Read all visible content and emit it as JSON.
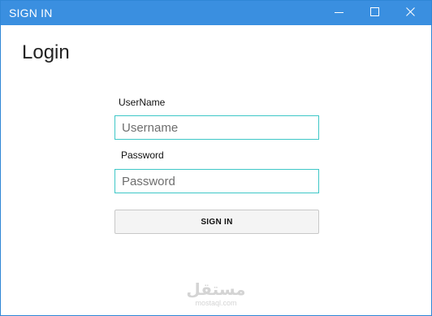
{
  "window": {
    "title": "SIGN IN",
    "controls": {
      "minimize_icon": "minimize-icon",
      "maximize_icon": "maximize-icon",
      "close_icon": "close-icon"
    },
    "accent_color": "#3a8fe0"
  },
  "main": {
    "heading": "Login",
    "username": {
      "label": "UserName",
      "placeholder": "Username",
      "value": ""
    },
    "password": {
      "label": "Password",
      "placeholder": "Password",
      "value": ""
    },
    "submit_label": "SIGN IN",
    "input_border_color": "#3ec7c7"
  },
  "watermark": {
    "main": "مستقل",
    "sub": "mostaql.com"
  }
}
